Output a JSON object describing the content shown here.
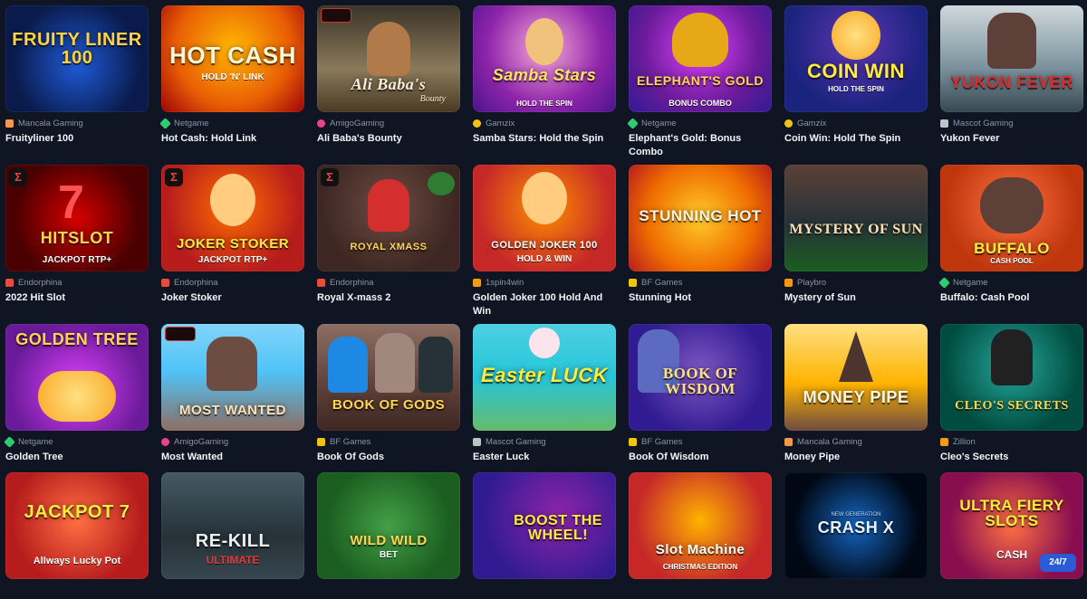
{
  "games": [
    {
      "name": "Fruityliner 100",
      "provider": "Mancala Gaming",
      "art": "FRUITY LINER 100",
      "art_sub": "",
      "provider_color": "#f2994a"
    },
    {
      "name": "Hot Cash: Hold Link",
      "provider": "Netgame",
      "art": "HOT CASH",
      "art_sub": "HOLD 'N' LINK",
      "provider_color": "#2ecc71"
    },
    {
      "name": "Ali Baba's Bounty",
      "provider": "AmigoGaming",
      "art": "Ali Baba's",
      "art_sub": "Bounty",
      "provider_color": "#e84393"
    },
    {
      "name": "Samba Stars: Hold the Spin",
      "provider": "Gamzix",
      "art": "Samba Stars",
      "art_sub": "HOLD THE SPIN",
      "provider_color": "#f1c40f"
    },
    {
      "name": "Elephant's Gold: Bonus Combo",
      "provider": "Netgame",
      "art": "ELEPHANT'S GOLD",
      "art_sub": "BONUS COMBO",
      "provider_color": "#2ecc71"
    },
    {
      "name": "Coin Win: Hold The Spin",
      "provider": "Gamzix",
      "art": "COIN WIN",
      "art_sub": "HOLD THE SPIN",
      "provider_color": "#f1c40f"
    },
    {
      "name": "Yukon Fever",
      "provider": "Mascot Gaming",
      "art": "YUKON FEVER",
      "art_sub": "",
      "provider_color": "#bdc3c7"
    },
    {
      "name": "2022 Hit Slot",
      "provider": "Endorphina",
      "art": "HITSLOT",
      "art_sub": "JACKPOT RTP+",
      "provider_color": "#e74c3c"
    },
    {
      "name": "Joker Stoker",
      "provider": "Endorphina",
      "art": "JOKER STOKER",
      "art_sub": "JACKPOT RTP+",
      "provider_color": "#e74c3c"
    },
    {
      "name": "Royal X-mass 2",
      "provider": "Endorphina",
      "art": "ROYAL XMASS",
      "art_sub": "",
      "provider_color": "#e74c3c"
    },
    {
      "name": "Golden Joker 100 Hold And Win",
      "provider": "1spin4win",
      "art": "GOLDEN JOKER 100",
      "art_sub": "HOLD & WIN",
      "provider_color": "#f39c12"
    },
    {
      "name": "Stunning Hot",
      "provider": "BF Games",
      "art": "STUNNING HOT",
      "art_sub": "",
      "provider_color": "#f1c40f"
    },
    {
      "name": "Mystery of Sun",
      "provider": "Playbro",
      "art": "MYSTERY OF SUN",
      "art_sub": "",
      "provider_color": "#f39c12"
    },
    {
      "name": "Buffalo: Cash Pool",
      "provider": "Netgame",
      "art": "BUFFALO",
      "art_sub": "CASH POOL",
      "provider_color": "#2ecc71"
    },
    {
      "name": "Golden Tree",
      "provider": "Netgame",
      "art": "GOLDEN TREE",
      "art_sub": "",
      "provider_color": "#2ecc71"
    },
    {
      "name": "Most Wanted",
      "provider": "AmigoGaming",
      "art": "MOST WANTED",
      "art_sub": "",
      "provider_color": "#e84393"
    },
    {
      "name": "Book Of Gods",
      "provider": "BF Games",
      "art": "BOOK OF GODS",
      "art_sub": "",
      "provider_color": "#f1c40f"
    },
    {
      "name": "Easter Luck",
      "provider": "Mascot Gaming",
      "art": "Easter LUCK",
      "art_sub": "",
      "provider_color": "#bdc3c7"
    },
    {
      "name": "Book Of Wisdom",
      "provider": "BF Games",
      "art": "BOOK OF WISDOM",
      "art_sub": "",
      "provider_color": "#f1c40f"
    },
    {
      "name": "Money Pipe",
      "provider": "Mancala Gaming",
      "art": "MONEY PIPE",
      "art_sub": "",
      "provider_color": "#f2994a"
    },
    {
      "name": "Cleo's Secrets",
      "provider": "Zillion",
      "art": "CLEO'S SECRETS",
      "art_sub": "",
      "provider_color": "#f39c12"
    }
  ],
  "row4": [
    {
      "art": "JACKPOT 7",
      "art_sub": "Allways Lucky Pot"
    },
    {
      "art": "RE-KILL",
      "art_sub": "ULTIMATE"
    },
    {
      "art": "WILD WILD",
      "art_sub": "BET"
    },
    {
      "art": "BOOST THE WHEEL!",
      "art_sub": ""
    },
    {
      "art": "Slot Machine",
      "art_sub": "CHRISTMAS EDITION"
    },
    {
      "art": "CRASH X",
      "art_sub": "NEW GENERATION"
    },
    {
      "art": "ULTRA FIERY SLOTS",
      "art_sub": "CASH"
    }
  ],
  "chat_label": "24/7",
  "colors": {
    "background": "#0f1522",
    "text": "#f2f4f8",
    "muted": "#8a93a6",
    "chat": "#2b5bd6"
  }
}
